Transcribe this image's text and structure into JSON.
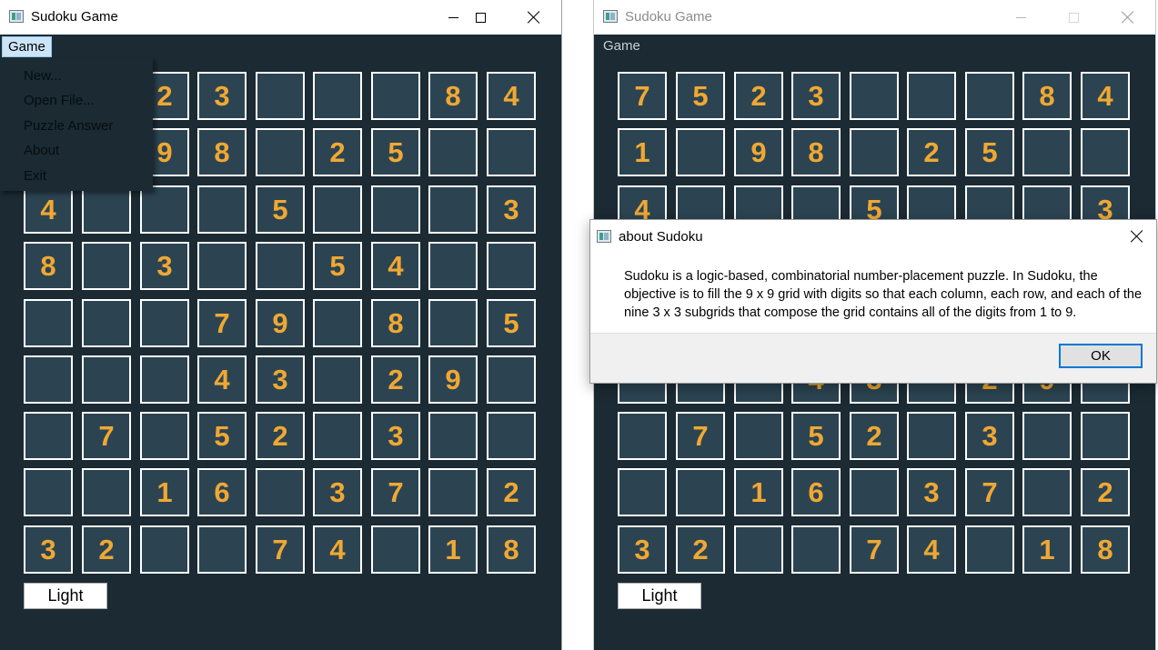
{
  "left_window": {
    "title": "Sudoku Game",
    "menu": "Game",
    "dropdown": [
      "New...",
      "Open File...",
      "Puzzle Answer",
      "About",
      "Exit"
    ],
    "light_button": "Light"
  },
  "right_window": {
    "title": "Sudoku Game",
    "menu": "Game",
    "light_button": "Light"
  },
  "board": [
    [
      "7",
      "5",
      "2",
      "3",
      "",
      "",
      "",
      "8",
      "4"
    ],
    [
      "1",
      "",
      "9",
      "8",
      "",
      "2",
      "5",
      "",
      ""
    ],
    [
      "4",
      "",
      "",
      "",
      "5",
      "",
      "",
      "",
      "3"
    ],
    [
      "8",
      "",
      "3",
      "",
      "",
      "5",
      "4",
      "",
      ""
    ],
    [
      "",
      "",
      "",
      "7",
      "9",
      "",
      "8",
      "",
      "5"
    ],
    [
      "",
      "",
      "",
      "4",
      "3",
      "",
      "2",
      "9",
      ""
    ],
    [
      "",
      "7",
      "",
      "5",
      "2",
      "",
      "3",
      "",
      ""
    ],
    [
      "",
      "",
      "1",
      "6",
      "",
      "3",
      "7",
      "",
      "2"
    ],
    [
      "3",
      "2",
      "",
      "",
      "7",
      "4",
      "",
      "1",
      "8"
    ]
  ],
  "dialog": {
    "title": "about Sudoku",
    "message": "Sudoku is a logic-based, combinatorial number-placement puzzle. In Sudoku, the objective is to fill the 9 x 9 grid with digits so that each column, each row, and each of the nine 3 x 3 subgrids that compose the grid contains all of the digits from 1 to 9.",
    "ok_label": "OK"
  },
  "colors": {
    "window_bg": "#1b2a33",
    "cell_bg": "#2c4452",
    "cell_border": "#ffffff",
    "digit": "#f0a833"
  }
}
